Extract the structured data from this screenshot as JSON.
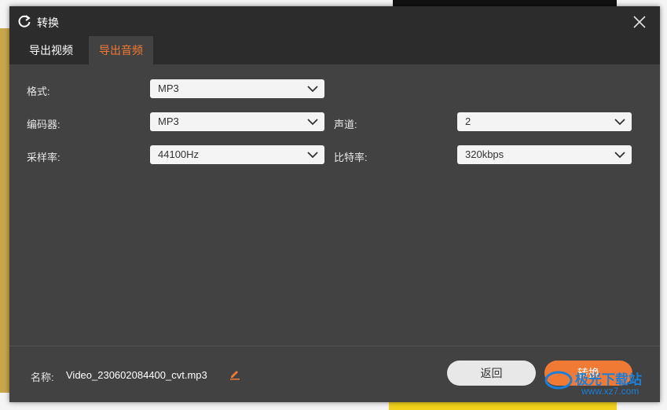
{
  "dialog": {
    "title": "转换"
  },
  "tabs": [
    {
      "label": "导出视频",
      "active": false
    },
    {
      "label": "导出音频",
      "active": true
    }
  ],
  "settings": {
    "format": {
      "label": "格式:",
      "value": "MP3"
    },
    "encoder": {
      "label": "编码器:",
      "value": "MP3"
    },
    "channels": {
      "label": "声道:",
      "value": "2"
    },
    "sample_rate": {
      "label": "采样率:",
      "value": "44100Hz"
    },
    "bitrate": {
      "label": "比特率:",
      "value": "320kbps"
    }
  },
  "footer": {
    "name_label": "名称:",
    "name_value": "Video_230602084400_cvt.mp3",
    "back_label": "返回",
    "convert_label": "转换"
  },
  "watermark": {
    "line1": "极光下载站",
    "line2": "www.xz7.com"
  },
  "colors": {
    "accent": "#f07a34",
    "dialog_bg": "#424242",
    "titlebar_bg": "#2c2c2c"
  }
}
